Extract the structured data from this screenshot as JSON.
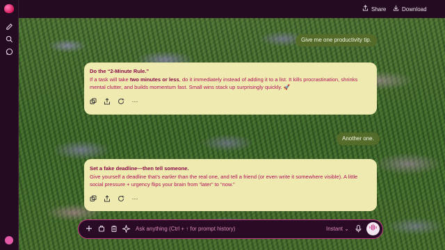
{
  "topbar": {
    "share_label": "Share",
    "download_label": "Download"
  },
  "sidebar": {
    "items": [
      {
        "icon": "new-chat-icon"
      },
      {
        "icon": "search-icon"
      },
      {
        "icon": "chat-bubble-icon"
      }
    ],
    "avatar_initials": "?"
  },
  "conversation": {
    "msg1": "Give me one productivity tip.",
    "reply1": {
      "title": "Do the “2-Minute Rule.”",
      "pre": "If a task will take ",
      "bold": "two minutes or less",
      "post": ", do it immediately instead of adding it to a list. It kills procrastination, shrinks mental clutter, and builds momentum fast. Small wins stack up surprisingly quickly. 🚀"
    },
    "msg2": "Another one.",
    "reply2": {
      "title": "Set a fake deadline—then tell someone.",
      "pre": "Give yourself a deadline that’s ",
      "italic": "earlier",
      "post": " than the real one, and tell a friend (or even write it somewhere visible). A little social pressure + urgency flips your brain from “later” to “now.”"
    }
  },
  "composer": {
    "placeholder": "Ask anything (Ctrl + ↑ for prompt history)",
    "mode": "Instant"
  },
  "colors": {
    "accent": "#c23a87",
    "card_bg": "#efeab0",
    "user_bubble": "#556b2a",
    "chrome": "#240b22"
  }
}
